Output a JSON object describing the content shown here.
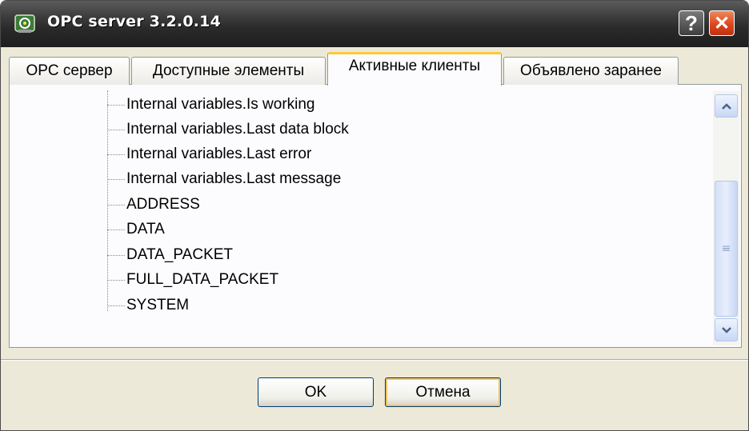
{
  "window": {
    "title": "OPC server 3.2.0.14",
    "help_label": "?",
    "close_label": "✕"
  },
  "tabs": [
    {
      "label": "OPC сервер",
      "active": false
    },
    {
      "label": "Доступные элементы",
      "active": false
    },
    {
      "label": "Активные клиенты",
      "active": true
    },
    {
      "label": "Объявлено заранее",
      "active": false
    }
  ],
  "tree": {
    "items": [
      "Internal variables.Is working",
      "Internal variables.Last data block",
      "Internal variables.Last error",
      "Internal variables.Last message",
      "ADDRESS",
      "DATA",
      "DATA_PACKET",
      "FULL_DATA_PACKET",
      "SYSTEM"
    ]
  },
  "scrollbar": {
    "up_icon": "scroll-up-arrow",
    "down_icon": "scroll-down-arrow",
    "thumb_grip": "≡"
  },
  "buttons": {
    "ok": "OK",
    "cancel": "Отмена"
  },
  "colors": {
    "titlebar": "#2a2a2a",
    "active_tab_accent": "#ffc83c",
    "close_button": "#d8431a"
  }
}
